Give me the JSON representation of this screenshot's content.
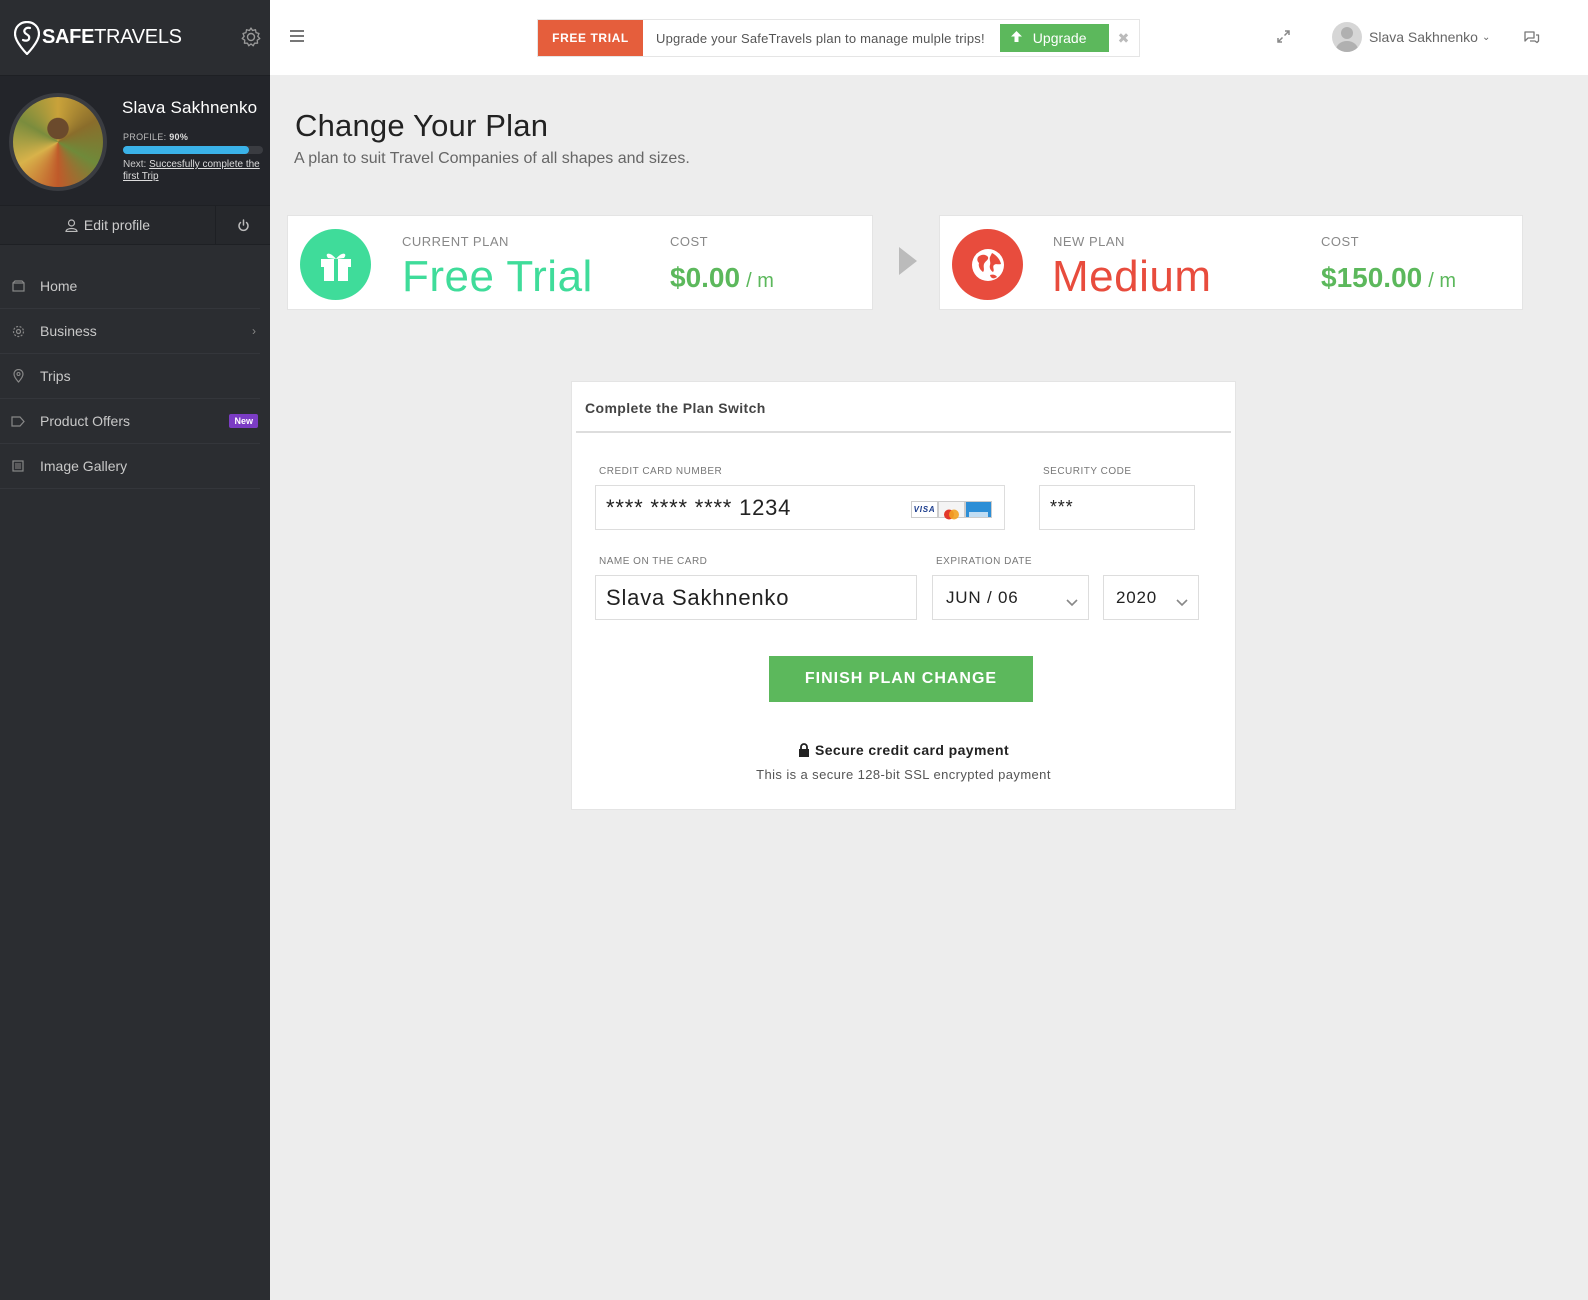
{
  "brand": {
    "name_bold": "SAFE",
    "name_light": "TRAVELS",
    "accent": "#3ab2e8"
  },
  "profile": {
    "name": "Slava Sakhnenko",
    "completion_label": "PROFILE:",
    "completion_value": "90%",
    "completion_fraction": 0.9,
    "next_label": "Next:",
    "next_task": "Succesfully complete the first Trip",
    "edit_label": "Edit profile"
  },
  "sidebar": {
    "items": [
      {
        "label": "Home",
        "icon": "home-icon"
      },
      {
        "label": "Business",
        "icon": "business-gear-icon",
        "chevron": "›"
      },
      {
        "label": "Trips",
        "icon": "map-pin-icon"
      },
      {
        "label": "Product Offers",
        "icon": "tag-icon",
        "badge": "New"
      },
      {
        "label": "Image Gallery",
        "icon": "gallery-icon"
      }
    ]
  },
  "topbar": {
    "trial_tag": "FREE TRIAL",
    "trial_message": "Upgrade your SafeTravels plan to manage mulple trips!",
    "upgrade_label": "Upgrade",
    "close_glyph": "✖",
    "user_name": "Slava Sakhnenko",
    "user_caret": "⌄"
  },
  "page": {
    "title": "Change Your Plan",
    "subtitle": "A plan to suit Travel Companies of all shapes and sizes."
  },
  "plans": {
    "current": {
      "label": "CURRENT PLAN",
      "name": "Free Trial",
      "cost_label": "COST",
      "cost": "$0.00",
      "per": "/ m",
      "color": "#3fdc9a",
      "icon": "gift-icon"
    },
    "new": {
      "label": "NEW PLAN",
      "name": "Medium",
      "cost_label": "COST",
      "cost": "$150.00",
      "per": "/ m",
      "color": "#e84c3d",
      "icon": "globe-icon"
    }
  },
  "switch_form": {
    "heading": "Complete the Plan Switch",
    "card_number_label": "CREDIT CARD NUMBER",
    "card_number": "**** **** **** 1234",
    "security_label": "SECURITY CODE",
    "security_code": "***",
    "name_label": "NAME ON THE CARD",
    "name_value": "Slava Sakhnenko",
    "expiry_label": "EXPIRATION DATE",
    "expiry_month": "JUN / 06",
    "expiry_year": "2020",
    "card_brands": [
      "VISA",
      "MasterCard",
      "American Express"
    ],
    "submit_label": "FINISH PLAN CHANGE",
    "secure_title": "Secure credit card payment",
    "secure_sub": "This is a secure 128-bit SSL encrypted payment"
  }
}
